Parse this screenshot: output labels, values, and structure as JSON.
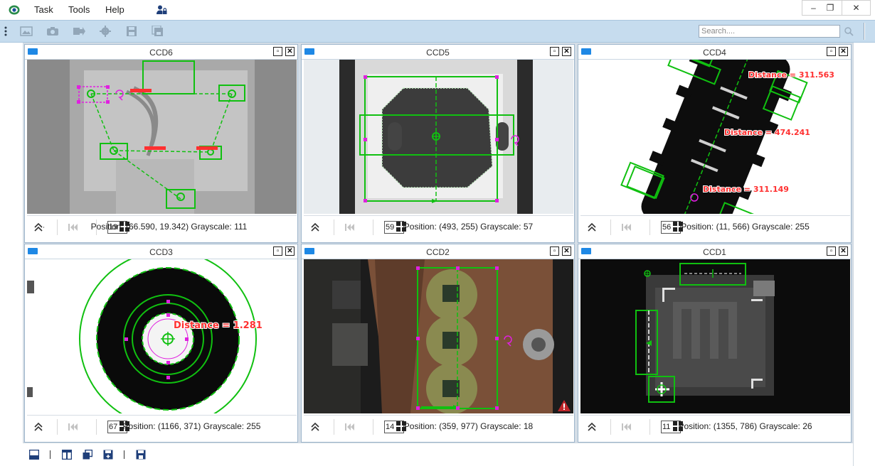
{
  "menu": {
    "items": [
      "Task",
      "Tools",
      "Help"
    ]
  },
  "window": {
    "minimize": "–",
    "restore": "❐",
    "close": "✕"
  },
  "toolbar": {
    "search_placeholder": "Search...."
  },
  "colors": {
    "accent": "#1e88e5",
    "overlay_green": "#10c010",
    "handle_magenta": "#e020e0",
    "distance_red": "#ff3030",
    "toolbar_bg": "#c6dcee"
  },
  "panels": [
    {
      "title": "CCD6",
      "index_value": "19",
      "position_text": "Position: (66.590, 19.342) Grayscale: 111",
      "info_prefix": "›"
    },
    {
      "title": "CCD5",
      "index_value": "59",
      "position_text": "Position: (493, 255) Grayscale: 57"
    },
    {
      "title": "CCD4",
      "index_value": "56",
      "position_text": "Position: (11, 566) Grayscale: 255",
      "distances": [
        "Distance = 311.563",
        "Distance = 474.241",
        "Distance = 311.149"
      ]
    },
    {
      "title": "CCD3",
      "index_value": "67",
      "position_text": "Position: (1166, 371) Grayscale: 255",
      "distances": [
        "Distance = 1.281"
      ]
    },
    {
      "title": "CCD2",
      "index_value": "14",
      "position_text": "Position: (359, 977) Grayscale: 18",
      "warning": true
    },
    {
      "title": "CCD1",
      "index_value": "11",
      "position_text": "Position: (1355, 786) Grayscale: 26"
    }
  ],
  "icons": {
    "menubar": [
      "app-logo-icon",
      "user-lock-icon"
    ],
    "toolbar": [
      "grip-icon",
      "image-icon",
      "camera-icon",
      "export-icon",
      "gear-icon",
      "save-icon",
      "save-copy-icon",
      "search-icon"
    ],
    "bottombar": [
      "layout-single-icon",
      "layout-split-icon",
      "layout-cascade-icon",
      "save-layout-icon",
      "save-all-icon"
    ]
  }
}
